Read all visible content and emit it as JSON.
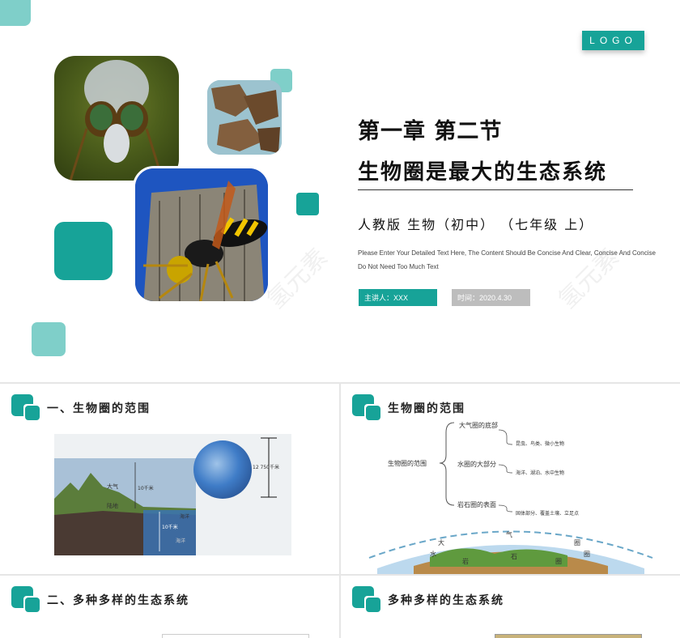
{
  "main": {
    "logo": "LOGO",
    "title_line1": "第一章  第二节",
    "title_line2": "生物圈是最大的生态系统",
    "edition": "人教版  生物（初中）  （七年级 上）",
    "description": "Please Enter Your Detailed Text Here, The Content Should Be Concise And Clear, Concise And Concise Do Not Need Too Much Text",
    "speaker": "主讲人：XXX",
    "time": "时间：2020.4.30",
    "watermark": "氢元素"
  },
  "slide2": {
    "title": "一、生物圈的范围",
    "labels": {
      "atmosphere": "大气",
      "land": "陆地",
      "sea": "海洋",
      "ocean": "海洋",
      "ten_km_up": "10千米",
      "ten_km_down": "10千米",
      "earth_radius": "12 750千米"
    }
  },
  "slide3": {
    "title": "生物圈的范围",
    "root": "生物圈的范围",
    "branches": [
      {
        "label": "大气圈的底部",
        "detail": "昆虫、鸟类、微小生物"
      },
      {
        "label": "水圈的大部分",
        "detail": "海洋、湖泊、水中生物"
      },
      {
        "label": "岩石圈的表面",
        "detail": "固体部分、覆盖土壤、立足点"
      }
    ],
    "arc_chars": [
      "大",
      "气",
      "圈",
      "水",
      "圈",
      "岩",
      "石",
      "圈"
    ]
  },
  "slide4": {
    "title": "二、多种多样的生态系统"
  },
  "slide5": {
    "title": "多种多样的生态系统"
  },
  "colors": {
    "accent": "#17a398",
    "accent_light": "#7fcfc9",
    "gray_pill": "#bdbdbd"
  }
}
